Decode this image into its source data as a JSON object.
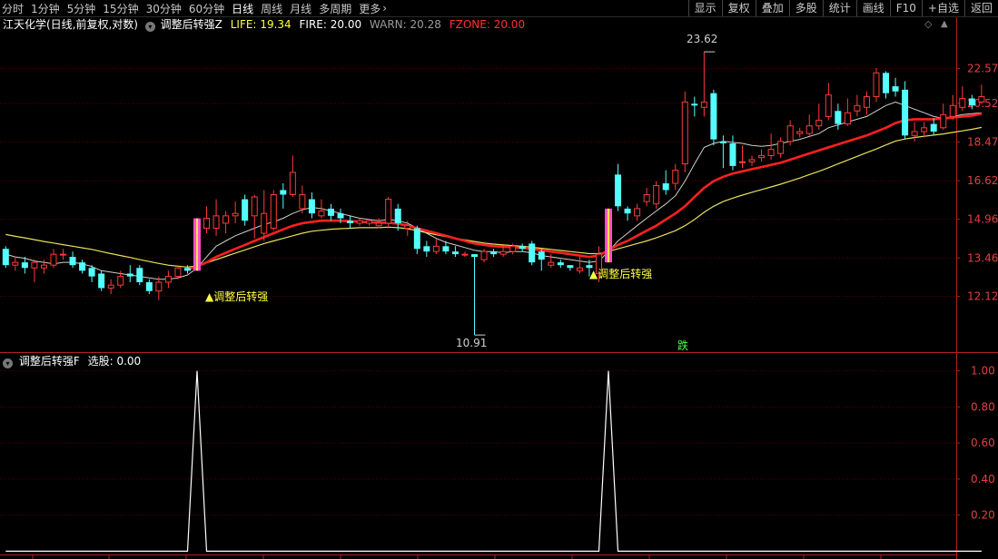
{
  "toolbar": {
    "periods": [
      "分时",
      "1分钟",
      "5分钟",
      "15分钟",
      "30分钟",
      "60分钟",
      "日线",
      "周线",
      "月线",
      "多周期",
      "更多"
    ],
    "active_period": "日线",
    "more_arrow": "›",
    "right_buttons": [
      "显示",
      "复权",
      "叠加",
      "多股",
      "统计",
      "画线",
      "F10",
      "+自选",
      "返回"
    ]
  },
  "main_panel": {
    "stock_title": "江天化学(日线,前复权,对数)",
    "indicator_name": "调整后转强Z",
    "life_label": "LIFE:",
    "life_value": "19.34",
    "fire_label": "FIRE:",
    "fire_value": "20.00",
    "warn_label": "WARN:",
    "warn_value": "20.28",
    "fzone_label": "FZONE:",
    "fzone_value": "20.00",
    "signal_text": "▲调整后转强",
    "high_label": "23.62",
    "low_label": "10.91",
    "die_badge": "跌"
  },
  "sub_panel": {
    "indicator_name": "调整后转强F",
    "select_label": "选股:",
    "select_value": "0.00"
  },
  "colors": {
    "up": "#ff3a3a",
    "down": "#54ffff",
    "life_line": "#ff2020",
    "ma_white": "#cfcfcf",
    "ma_yellow": "#e8e05a",
    "grid": "#5a0000",
    "axis_text": "#e04040",
    "signal_bar_pink": "#ff4fc8",
    "signal_bar_yellow": "#ffe14a"
  },
  "chart_data": [
    {
      "type": "candlestick",
      "scale": "log",
      "y_ticks": [
        12.12,
        13.46,
        14.96,
        16.62,
        18.47,
        20.52,
        22.57
      ],
      "candles": [
        [
          13.8,
          13.2,
          13.9,
          13.1
        ],
        [
          13.2,
          13.3,
          13.5,
          13.0
        ],
        [
          13.3,
          13.1,
          13.5,
          12.9
        ],
        [
          13.1,
          13.3,
          13.4,
          12.6
        ],
        [
          13.1,
          13.2,
          13.4,
          12.9
        ],
        [
          13.2,
          13.6,
          13.8,
          13.1
        ],
        [
          13.6,
          13.6,
          13.8,
          13.4
        ],
        [
          13.5,
          13.2,
          13.7,
          13.1
        ],
        [
          13.3,
          13.0,
          13.4,
          12.9
        ],
        [
          13.1,
          12.8,
          13.2,
          12.6
        ],
        [
          12.9,
          12.4,
          13.0,
          12.3
        ],
        [
          12.4,
          12.5,
          12.7,
          12.2
        ],
        [
          12.5,
          12.8,
          13.0,
          12.4
        ],
        [
          12.9,
          12.8,
          13.2,
          12.6
        ],
        [
          13.1,
          12.6,
          13.2,
          12.5
        ],
        [
          12.6,
          12.3,
          12.7,
          12.2
        ],
        [
          12.3,
          12.6,
          12.8,
          12.0
        ],
        [
          12.6,
          12.8,
          13.0,
          12.4
        ],
        [
          12.8,
          13.1,
          13.2,
          12.7
        ],
        [
          13.1,
          13.0,
          13.2,
          12.9
        ],
        [
          13.0,
          14.6,
          15.0,
          13.0
        ],
        [
          14.6,
          15.0,
          15.5,
          14.4
        ],
        [
          14.6,
          15.1,
          15.8,
          14.3
        ],
        [
          14.8,
          15.1,
          15.3,
          14.4
        ],
        [
          15.1,
          15.2,
          15.7,
          14.8
        ],
        [
          15.8,
          14.9,
          16.0,
          14.7
        ],
        [
          15.1,
          15.9,
          16.0,
          14.2
        ],
        [
          14.4,
          15.2,
          16.2,
          14.1
        ],
        [
          14.6,
          16.0,
          16.2,
          14.5
        ],
        [
          16.2,
          16.0,
          16.5,
          15.4
        ],
        [
          16.0,
          17.0,
          17.8,
          15.9
        ],
        [
          15.4,
          16.0,
          16.4,
          15.2
        ],
        [
          15.8,
          15.2,
          16.1,
          15.0
        ],
        [
          15.1,
          15.3,
          15.8,
          15.0
        ],
        [
          15.4,
          15.1,
          15.6,
          14.9
        ],
        [
          15.2,
          15.0,
          15.4,
          14.8
        ],
        [
          14.9,
          14.8,
          15.1,
          14.6
        ],
        [
          14.8,
          14.9,
          15.0,
          14.7
        ],
        [
          14.8,
          14.9,
          14.9,
          14.7
        ],
        [
          14.7,
          14.8,
          15.0,
          14.6
        ],
        [
          14.8,
          15.8,
          15.9,
          14.6
        ],
        [
          15.4,
          14.8,
          15.6,
          14.5
        ],
        [
          14.6,
          14.7,
          14.9,
          14.3
        ],
        [
          14.6,
          13.8,
          14.7,
          13.6
        ],
        [
          13.9,
          13.7,
          14.1,
          13.5
        ],
        [
          13.7,
          13.9,
          14.2,
          13.6
        ],
        [
          13.9,
          13.7,
          14.1,
          13.6
        ],
        [
          13.7,
          13.6,
          13.9,
          13.5
        ],
        [
          13.6,
          13.6,
          13.7,
          13.5
        ],
        [
          13.6,
          13.5,
          13.6,
          10.91
        ],
        [
          13.4,
          13.7,
          13.8,
          13.3
        ],
        [
          13.7,
          13.6,
          13.8,
          13.5
        ],
        [
          13.6,
          13.7,
          13.9,
          13.5
        ],
        [
          13.7,
          13.9,
          14.0,
          13.6
        ],
        [
          13.9,
          13.8,
          14.0,
          13.7
        ],
        [
          14.0,
          13.3,
          14.1,
          13.2
        ],
        [
          13.7,
          13.4,
          13.8,
          13.0
        ],
        [
          13.2,
          13.3,
          13.6,
          13.1
        ],
        [
          13.3,
          13.2,
          13.4,
          13.1
        ],
        [
          13.2,
          13.1,
          13.2,
          13.0
        ],
        [
          13.0,
          13.1,
          13.5,
          12.9
        ],
        [
          13.2,
          13.1,
          13.4,
          12.8
        ],
        [
          12.9,
          13.6,
          13.9,
          12.6
        ],
        [
          13.3,
          15.3,
          15.4,
          13.3
        ],
        [
          16.9,
          15.5,
          17.4,
          15.3
        ],
        [
          15.4,
          15.2,
          15.5,
          14.9
        ],
        [
          15.1,
          15.4,
          15.6,
          14.9
        ],
        [
          15.7,
          16.0,
          16.3,
          15.5
        ],
        [
          15.6,
          16.4,
          16.6,
          15.4
        ],
        [
          16.5,
          16.2,
          17.1,
          16.0
        ],
        [
          16.5,
          17.1,
          17.4,
          16.2
        ],
        [
          17.4,
          20.6,
          21.2,
          17.0
        ],
        [
          20.5,
          20.4,
          20.9,
          19.8
        ],
        [
          20.3,
          20.6,
          23.62,
          19.8
        ],
        [
          21.1,
          18.6,
          21.3,
          18.3
        ],
        [
          18.5,
          18.4,
          18.8,
          17.2
        ],
        [
          18.4,
          17.3,
          18.8,
          17.1
        ],
        [
          17.5,
          17.5,
          18.3,
          17.2
        ],
        [
          17.5,
          17.6,
          17.8,
          17.3
        ],
        [
          17.7,
          17.8,
          18.1,
          17.5
        ],
        [
          17.8,
          18.1,
          18.9,
          17.6
        ],
        [
          17.9,
          18.5,
          18.7,
          17.7
        ],
        [
          18.5,
          19.3,
          19.6,
          18.3
        ],
        [
          18.9,
          19.0,
          19.2,
          18.7
        ],
        [
          18.9,
          19.3,
          19.9,
          18.8
        ],
        [
          19.3,
          19.6,
          20.5,
          19.1
        ],
        [
          19.8,
          21.0,
          21.7,
          19.6
        ],
        [
          20.1,
          19.4,
          20.5,
          19.1
        ],
        [
          19.4,
          20.0,
          20.8,
          19.3
        ],
        [
          20.1,
          20.4,
          21.0,
          19.8
        ],
        [
          20.3,
          20.9,
          21.2,
          19.9
        ],
        [
          20.9,
          22.3,
          22.6,
          20.6
        ],
        [
          22.3,
          21.1,
          22.4,
          20.8
        ],
        [
          21.5,
          21.2,
          22.0,
          20.9
        ],
        [
          21.3,
          18.8,
          21.8,
          18.6
        ],
        [
          18.8,
          19.0,
          19.5,
          18.5
        ],
        [
          19.0,
          19.2,
          19.5,
          18.7
        ],
        [
          19.4,
          19.0,
          19.7,
          18.8
        ],
        [
          19.2,
          19.9,
          20.5,
          19.1
        ],
        [
          19.8,
          20.4,
          21.0,
          19.6
        ],
        [
          20.3,
          20.8,
          21.5,
          20.1
        ],
        [
          20.8,
          20.4,
          21.0,
          20.2
        ],
        [
          20.6,
          20.9,
          21.6,
          20.5
        ]
      ],
      "ma_white": [
        13.6,
        13.5,
        13.45,
        13.35,
        13.3,
        13.25,
        13.3,
        13.3,
        13.25,
        13.15,
        13.0,
        12.95,
        12.9,
        12.85,
        12.8,
        12.75,
        12.7,
        12.7,
        12.75,
        12.85,
        13.1,
        13.5,
        13.9,
        14.1,
        14.3,
        14.45,
        14.6,
        14.75,
        14.85,
        15.0,
        15.2,
        15.35,
        15.45,
        15.4,
        15.3,
        15.2,
        15.1,
        15.0,
        14.95,
        14.9,
        14.95,
        14.9,
        14.8,
        14.6,
        14.4,
        14.2,
        14.05,
        13.95,
        13.85,
        13.75,
        13.7,
        13.7,
        13.65,
        13.7,
        13.7,
        13.65,
        13.55,
        13.5,
        13.45,
        13.4,
        13.35,
        13.3,
        13.35,
        13.7,
        14.1,
        14.4,
        14.7,
        15.0,
        15.3,
        15.6,
        15.95,
        16.6,
        17.4,
        18.2,
        18.4,
        18.5,
        18.45,
        18.4,
        18.3,
        18.25,
        18.3,
        18.4,
        18.5,
        18.6,
        18.75,
        18.9,
        19.2,
        19.35,
        19.5,
        19.65,
        19.8,
        20.1,
        20.4,
        20.6,
        20.4,
        20.2,
        20.0,
        19.8,
        19.7,
        19.8,
        19.9,
        19.95,
        20.0
      ],
      "ma_red_life": [
        null,
        null,
        null,
        null,
        null,
        null,
        null,
        null,
        null,
        null,
        null,
        null,
        null,
        null,
        null,
        null,
        null,
        null,
        null,
        13.05,
        13.15,
        13.3,
        13.5,
        13.65,
        13.8,
        13.95,
        14.1,
        14.25,
        14.4,
        14.55,
        14.7,
        14.8,
        14.85,
        14.9,
        14.9,
        14.9,
        14.88,
        14.86,
        14.84,
        14.82,
        14.82,
        14.78,
        14.7,
        14.6,
        14.5,
        14.4,
        14.3,
        14.2,
        14.1,
        14.0,
        13.95,
        13.9,
        13.88,
        13.86,
        13.84,
        13.8,
        13.75,
        13.7,
        13.65,
        13.6,
        13.55,
        13.5,
        13.55,
        13.75,
        13.95,
        14.1,
        14.3,
        14.5,
        14.7,
        14.95,
        15.2,
        15.5,
        15.9,
        16.3,
        16.6,
        16.8,
        16.95,
        17.05,
        17.15,
        17.25,
        17.35,
        17.45,
        17.6,
        17.75,
        17.9,
        18.05,
        18.2,
        18.35,
        18.5,
        18.65,
        18.8,
        19.0,
        19.2,
        19.45,
        19.6,
        19.65,
        19.65,
        19.65,
        19.7,
        19.75,
        19.8,
        19.85,
        19.95
      ],
      "ma_yellow": [
        14.35,
        14.28,
        14.22,
        14.15,
        14.08,
        14.02,
        13.96,
        13.9,
        13.84,
        13.78,
        13.7,
        13.62,
        13.55,
        13.48,
        13.4,
        13.33,
        13.26,
        13.2,
        13.16,
        13.13,
        13.18,
        13.28,
        13.4,
        13.52,
        13.64,
        13.76,
        13.88,
        14.0,
        14.1,
        14.2,
        14.3,
        14.4,
        14.48,
        14.52,
        14.56,
        14.58,
        14.6,
        14.62,
        14.62,
        14.62,
        14.64,
        14.62,
        14.58,
        14.5,
        14.42,
        14.34,
        14.27,
        14.2,
        14.14,
        14.08,
        14.02,
        13.98,
        13.95,
        13.92,
        13.9,
        13.86,
        13.82,
        13.78,
        13.74,
        13.7,
        13.66,
        13.62,
        13.62,
        13.7,
        13.8,
        13.9,
        14.0,
        14.1,
        14.22,
        14.36,
        14.5,
        14.7,
        14.95,
        15.25,
        15.5,
        15.7,
        15.85,
        15.98,
        16.1,
        16.22,
        16.34,
        16.46,
        16.6,
        16.74,
        16.9,
        17.05,
        17.22,
        17.4,
        17.58,
        17.76,
        17.94,
        18.12,
        18.32,
        18.52,
        18.62,
        18.7,
        18.76,
        18.82,
        18.88,
        18.96,
        19.04,
        19.12,
        19.22
      ],
      "signal_indices": [
        20,
        63
      ]
    },
    {
      "type": "line",
      "title": "调整后转强F",
      "y_ticks": [
        0.2,
        0.4,
        0.6,
        0.8,
        1.0
      ],
      "ylim": [
        0,
        1.09
      ],
      "values": [
        0,
        0,
        0,
        0,
        0,
        0,
        0,
        0,
        0,
        0,
        0,
        0,
        0,
        0,
        0,
        0,
        0,
        0,
        0,
        0,
        1,
        0,
        0,
        0,
        0,
        0,
        0,
        0,
        0,
        0,
        0,
        0,
        0,
        0,
        0,
        0,
        0,
        0,
        0,
        0,
        0,
        0,
        0,
        0,
        0,
        0,
        0,
        0,
        0,
        0,
        0,
        0,
        0,
        0,
        0,
        0,
        0,
        0,
        0,
        0,
        0,
        0,
        0,
        1,
        0,
        0,
        0,
        0,
        0,
        0,
        0,
        0,
        0,
        0,
        0,
        0,
        0,
        0,
        0,
        0,
        0,
        0,
        0,
        0,
        0,
        0,
        0,
        0,
        0,
        0,
        0,
        0,
        0,
        0,
        0,
        0,
        0,
        0,
        0,
        0,
        0,
        0,
        0
      ]
    }
  ]
}
